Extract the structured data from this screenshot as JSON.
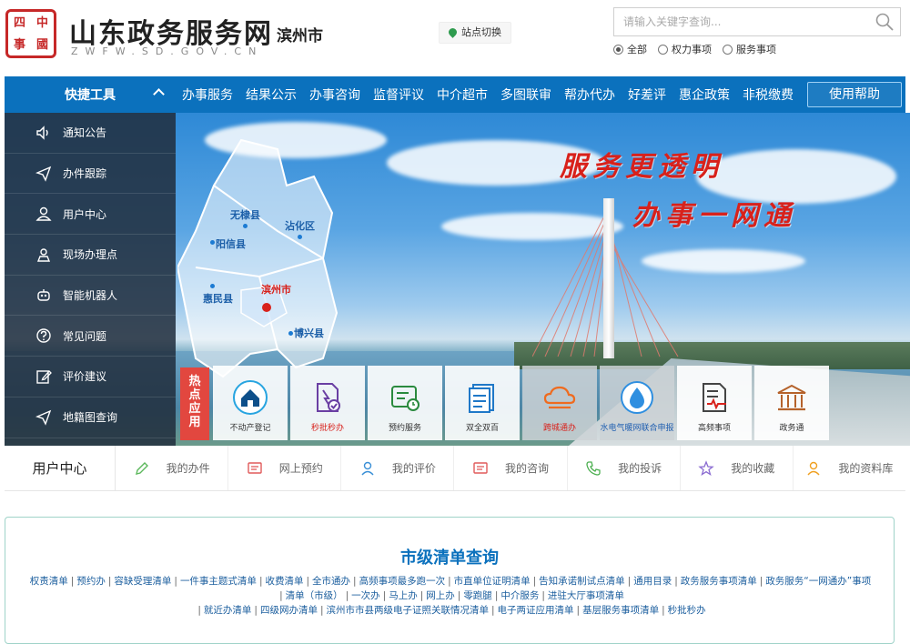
{
  "header": {
    "seal_chars": [
      "四",
      "中",
      "事",
      "國"
    ],
    "site_title": "山东政务服务网",
    "site_domain": "ZWFW.SD.GOV.CN",
    "city": "滨州市",
    "site_switch_label": "站点切换",
    "search_placeholder": "请输入关键字查询...",
    "scopes": [
      {
        "label": "全部",
        "checked": true
      },
      {
        "label": "权力事项",
        "checked": false
      },
      {
        "label": "服务事项",
        "checked": false
      }
    ]
  },
  "nav": {
    "quick_tools": "快捷工具",
    "items": [
      "办事服务",
      "结果公示",
      "办事咨询",
      "监督评议",
      "中介超市",
      "多图联审",
      "帮办代办",
      "好差评",
      "惠企政策",
      "非税缴费"
    ],
    "help": "使用帮助"
  },
  "side_menu": [
    {
      "label": "通知公告",
      "icon": "speaker-icon"
    },
    {
      "label": "办件跟踪",
      "icon": "paper-plane-icon"
    },
    {
      "label": "用户中心",
      "icon": "user-icon"
    },
    {
      "label": "现场办理点",
      "icon": "location-person-icon"
    },
    {
      "label": "智能机器人",
      "icon": "robot-icon"
    },
    {
      "label": "常见问题",
      "icon": "question-icon"
    },
    {
      "label": "评价建议",
      "icon": "edit-icon"
    },
    {
      "label": "地籍图查询",
      "icon": "send-icon"
    }
  ],
  "banner": {
    "slogan_1": "服务更透明",
    "slogan_2": "办事一网通",
    "map_labels": {
      "wudi": "无棣县",
      "zhanhua": "沾化区",
      "yangxin": "阳信县",
      "huimin": "惠民县",
      "binzhou": "滨州市",
      "boxing": "博兴县"
    }
  },
  "hot_apps": {
    "label": "热点应用",
    "items": [
      {
        "label": "不动产登记",
        "icon": "house-icon"
      },
      {
        "label": "秒批秒办",
        "icon": "document-check-icon"
      },
      {
        "label": "预约服务",
        "icon": "appointment-icon"
      },
      {
        "label": "双全双百",
        "icon": "clipboard-icon"
      },
      {
        "label": "跨城通办",
        "icon": "cloud-icon"
      },
      {
        "label": "水电气暖网联合申报",
        "icon": "water-drop-icon"
      },
      {
        "label": "高频事项",
        "icon": "document-pulse-icon"
      },
      {
        "label": "政务通",
        "icon": "building-icon"
      }
    ]
  },
  "user_center": {
    "title": "用户中心",
    "links": [
      {
        "label": "我的办件",
        "icon": "pencil-icon"
      },
      {
        "label": "网上预约",
        "icon": "message-icon"
      },
      {
        "label": "我的评价",
        "icon": "user-rating-icon"
      },
      {
        "label": "我的咨询",
        "icon": "chat-icon"
      },
      {
        "label": "我的投诉",
        "icon": "phone-icon"
      },
      {
        "label": "我的收藏",
        "icon": "star-icon"
      },
      {
        "label": "我的资料库",
        "icon": "person-icon"
      }
    ]
  },
  "city_list": {
    "title": "市级清单查询",
    "lines": [
      [
        "权责清单",
        "预约办",
        "容缺受理清单",
        "一件事主题式清单",
        "收费清单",
        "全市通办",
        "高频事项最多跑一次",
        "市直单位证明清单",
        "告知承诺制试点清单",
        "通用目录",
        "政务服务事项清单",
        "政务服务“一网通办”事项"
      ],
      [
        "清单（市级）",
        "一次办",
        "马上办",
        "网上办",
        "零跑腿",
        "中介服务",
        "进驻大厅事项清单"
      ],
      [
        "就近办清单",
        "四级网办清单",
        "滨州市市县两级电子证照关联情况清单",
        "电子两证应用清单",
        "基层服务事项清单",
        "秒批秒办"
      ]
    ]
  },
  "colors": {
    "nav_blue": "#0b71bd",
    "hot_red": "#e2473f",
    "slogan_red": "#d8211b",
    "title_blue": "#0b71bd"
  }
}
